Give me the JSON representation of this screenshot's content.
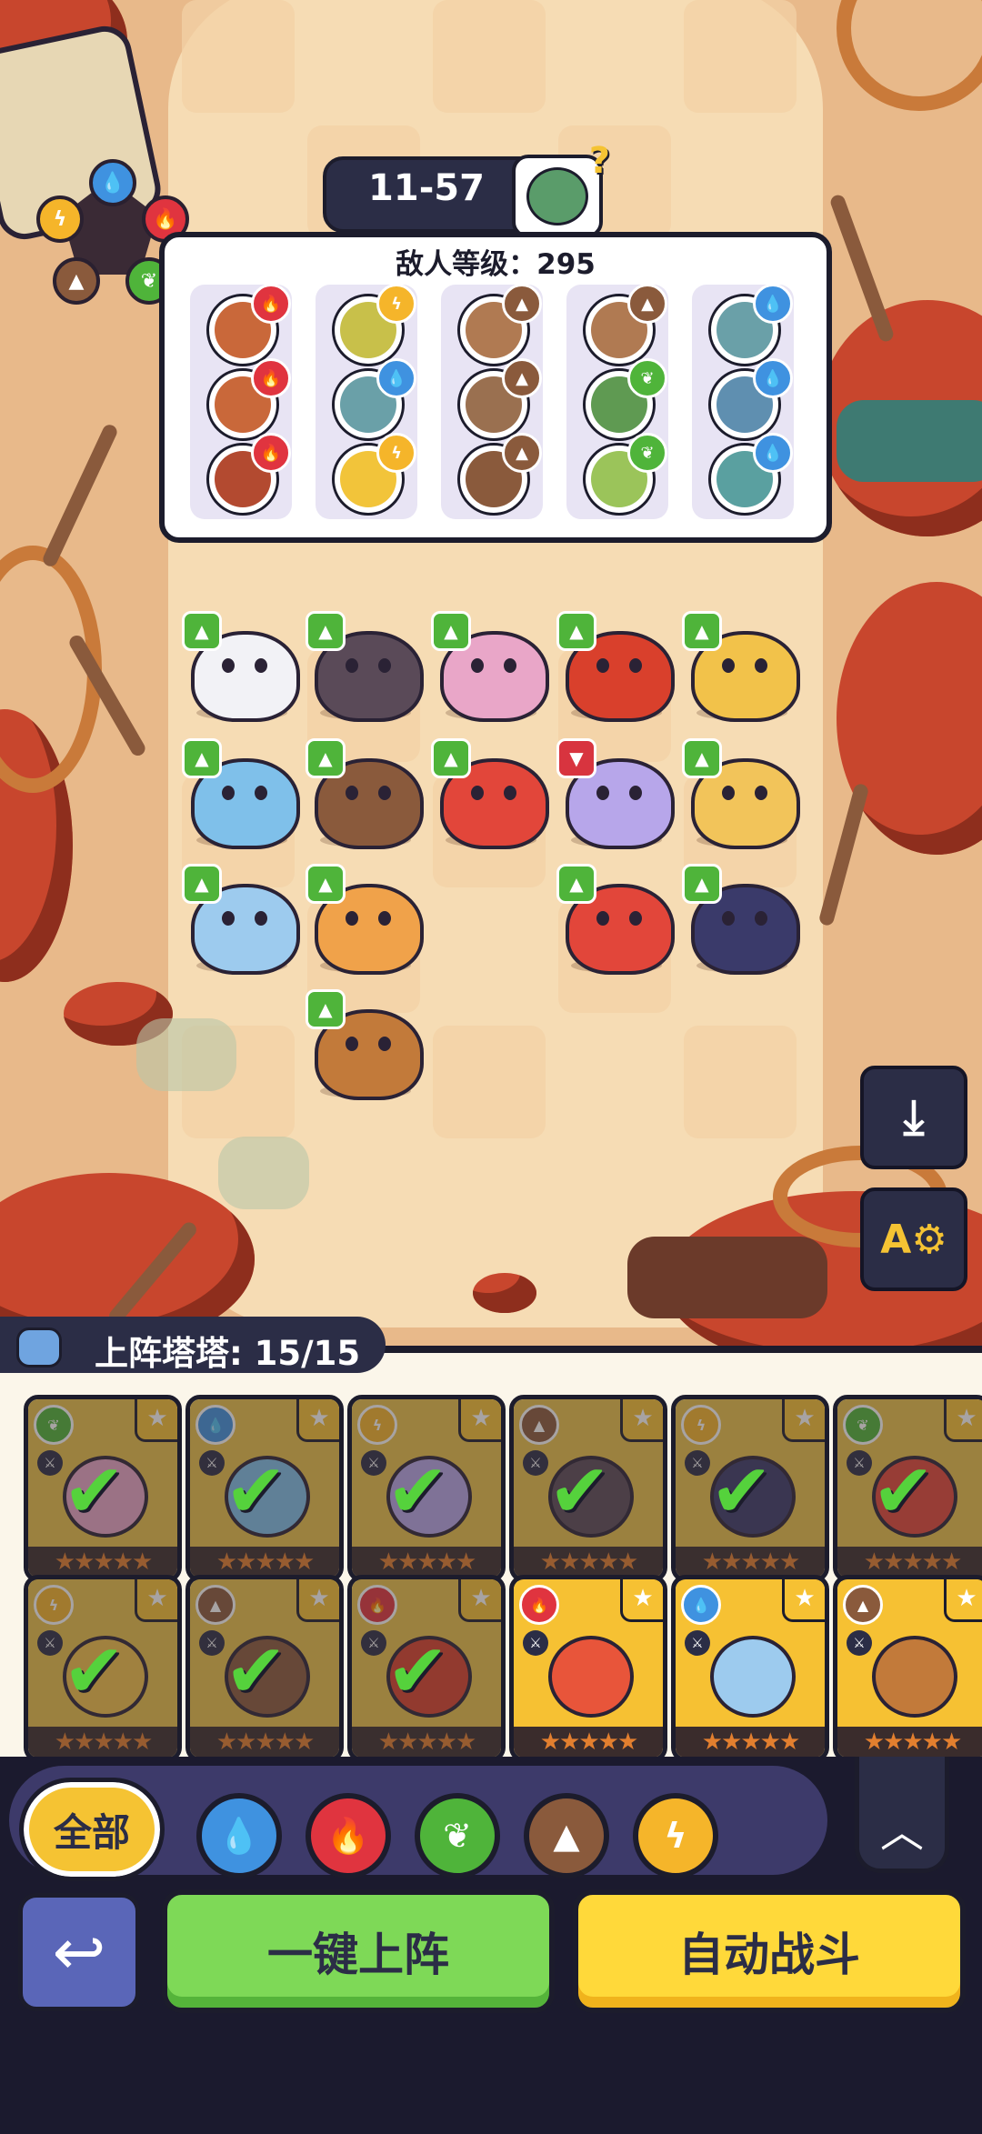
{
  "stage": {
    "number": "11-57",
    "boss_hint": "?"
  },
  "enemy": {
    "title": "敌人等级：295",
    "columns": [
      {
        "element": "fire",
        "color": "#e0343f",
        "monsters": [
          "#c9683a",
          "#c9683a",
          "#b34a30"
        ]
      },
      {
        "element": "electric",
        "color": "#f5b52a",
        "monsters": [
          "#c8c04a",
          "#6aa0a8",
          "#f2c43a"
        ]
      },
      {
        "element": "earth",
        "color": "#8a5a3c",
        "monsters": [
          "#b07a52",
          "#9a7050",
          "#8a5a3c"
        ]
      },
      {
        "element": "mixed",
        "color": "#8a5a3c",
        "monsters": [
          "#b07a52",
          "#5f9a52",
          "#9bc45a"
        ]
      },
      {
        "element": "water",
        "color": "#3f92e0",
        "monsters": [
          "#6aa0a8",
          "#5f8fb0",
          "#5aa0a0"
        ]
      }
    ],
    "badges": [
      [
        "fire",
        "fire",
        "fire"
      ],
      [
        "electric",
        "water",
        "electric"
      ],
      [
        "earth",
        "earth",
        "earth"
      ],
      [
        "earth",
        "grass",
        "grass"
      ],
      [
        "water",
        "water",
        "water"
      ]
    ]
  },
  "element_colors": {
    "water": "#3f92e0",
    "fire": "#e0343f",
    "grass": "#4fb43a",
    "earth": "#8a5a3c",
    "electric": "#f5b52a"
  },
  "units": [
    {
      "color": "#f2f2f6",
      "thumb": "up"
    },
    {
      "color": "#5a4a58",
      "thumb": "up"
    },
    {
      "color": "#e9a6c8",
      "thumb": "up"
    },
    {
      "color": "#d9402c",
      "thumb": "up"
    },
    {
      "color": "#f2c24a",
      "thumb": "up"
    },
    {
      "color": "#7fc0ea",
      "thumb": "up"
    },
    {
      "color": "#8a5a3c",
      "thumb": "up"
    },
    {
      "color": "#e2463a",
      "thumb": "up"
    },
    {
      "color": "#b7a6ea",
      "thumb": "down"
    },
    {
      "color": "#f2c45a",
      "thumb": "up"
    },
    {
      "color": "#9dcbee",
      "thumb": "up"
    },
    {
      "color": "#f0a24a",
      "thumb": "up"
    },
    {
      "color": "#e2463a",
      "thumb": "up"
    },
    {
      "color": "#3a3a6a",
      "thumb": "up"
    },
    {
      "color": "#c27a3a",
      "thumb": "up"
    }
  ],
  "side_buttons": {
    "download_icon": "download-icon",
    "auto_settings_label": "A⚙"
  },
  "roster": {
    "deployed_label": "上阵塔塔: 15/15",
    "cards": [
      {
        "element": "grass",
        "bg": "#e9c24a",
        "face": "#e9a6c8",
        "selected": true
      },
      {
        "element": "water",
        "bg": "#e9c24a",
        "face": "#7fc0ea",
        "selected": true
      },
      {
        "element": "electric",
        "bg": "#e9c24a",
        "face": "#b7a6ea",
        "selected": true
      },
      {
        "element": "earth",
        "bg": "#e9c24a",
        "face": "#5a4a58",
        "selected": true
      },
      {
        "element": "electric",
        "bg": "#e9c24a",
        "face": "#3a3a6a",
        "selected": true
      },
      {
        "element": "grass",
        "bg": "#e9c24a",
        "face": "#e2463a",
        "selected": true
      },
      {
        "element": "electric",
        "bg": "#e9c24a",
        "face": "#f2c24a",
        "selected": true
      },
      {
        "element": "earth",
        "bg": "#e9c24a",
        "face": "#8a5a3c",
        "selected": true
      },
      {
        "element": "fire",
        "bg": "#e9c24a",
        "face": "#d9402c",
        "selected": true
      },
      {
        "element": "fire",
        "bg": "#f6c133",
        "face": "#e8553a",
        "selected": false
      },
      {
        "element": "water",
        "bg": "#f6c133",
        "face": "#9dcbee",
        "selected": false
      },
      {
        "element": "earth",
        "bg": "#f6c133",
        "face": "#c27a3a",
        "selected": false
      }
    ],
    "star_row": "★★★★★"
  },
  "filters": {
    "all_label": "全部",
    "items": [
      {
        "name": "water",
        "color": "#3f92e0",
        "glyph": "💧"
      },
      {
        "name": "fire",
        "color": "#e0343f",
        "glyph": "🔥"
      },
      {
        "name": "grass",
        "color": "#4fb43a",
        "glyph": "❦"
      },
      {
        "name": "earth",
        "color": "#8a5a3c",
        "glyph": "▲"
      },
      {
        "name": "electric",
        "color": "#f5b52a",
        "glyph": "ϟ"
      }
    ],
    "collapse_glyph": "︿"
  },
  "actions": {
    "back_glyph": "↩",
    "deploy_label": "一键上阵",
    "auto_battle_label": "自动战斗"
  }
}
